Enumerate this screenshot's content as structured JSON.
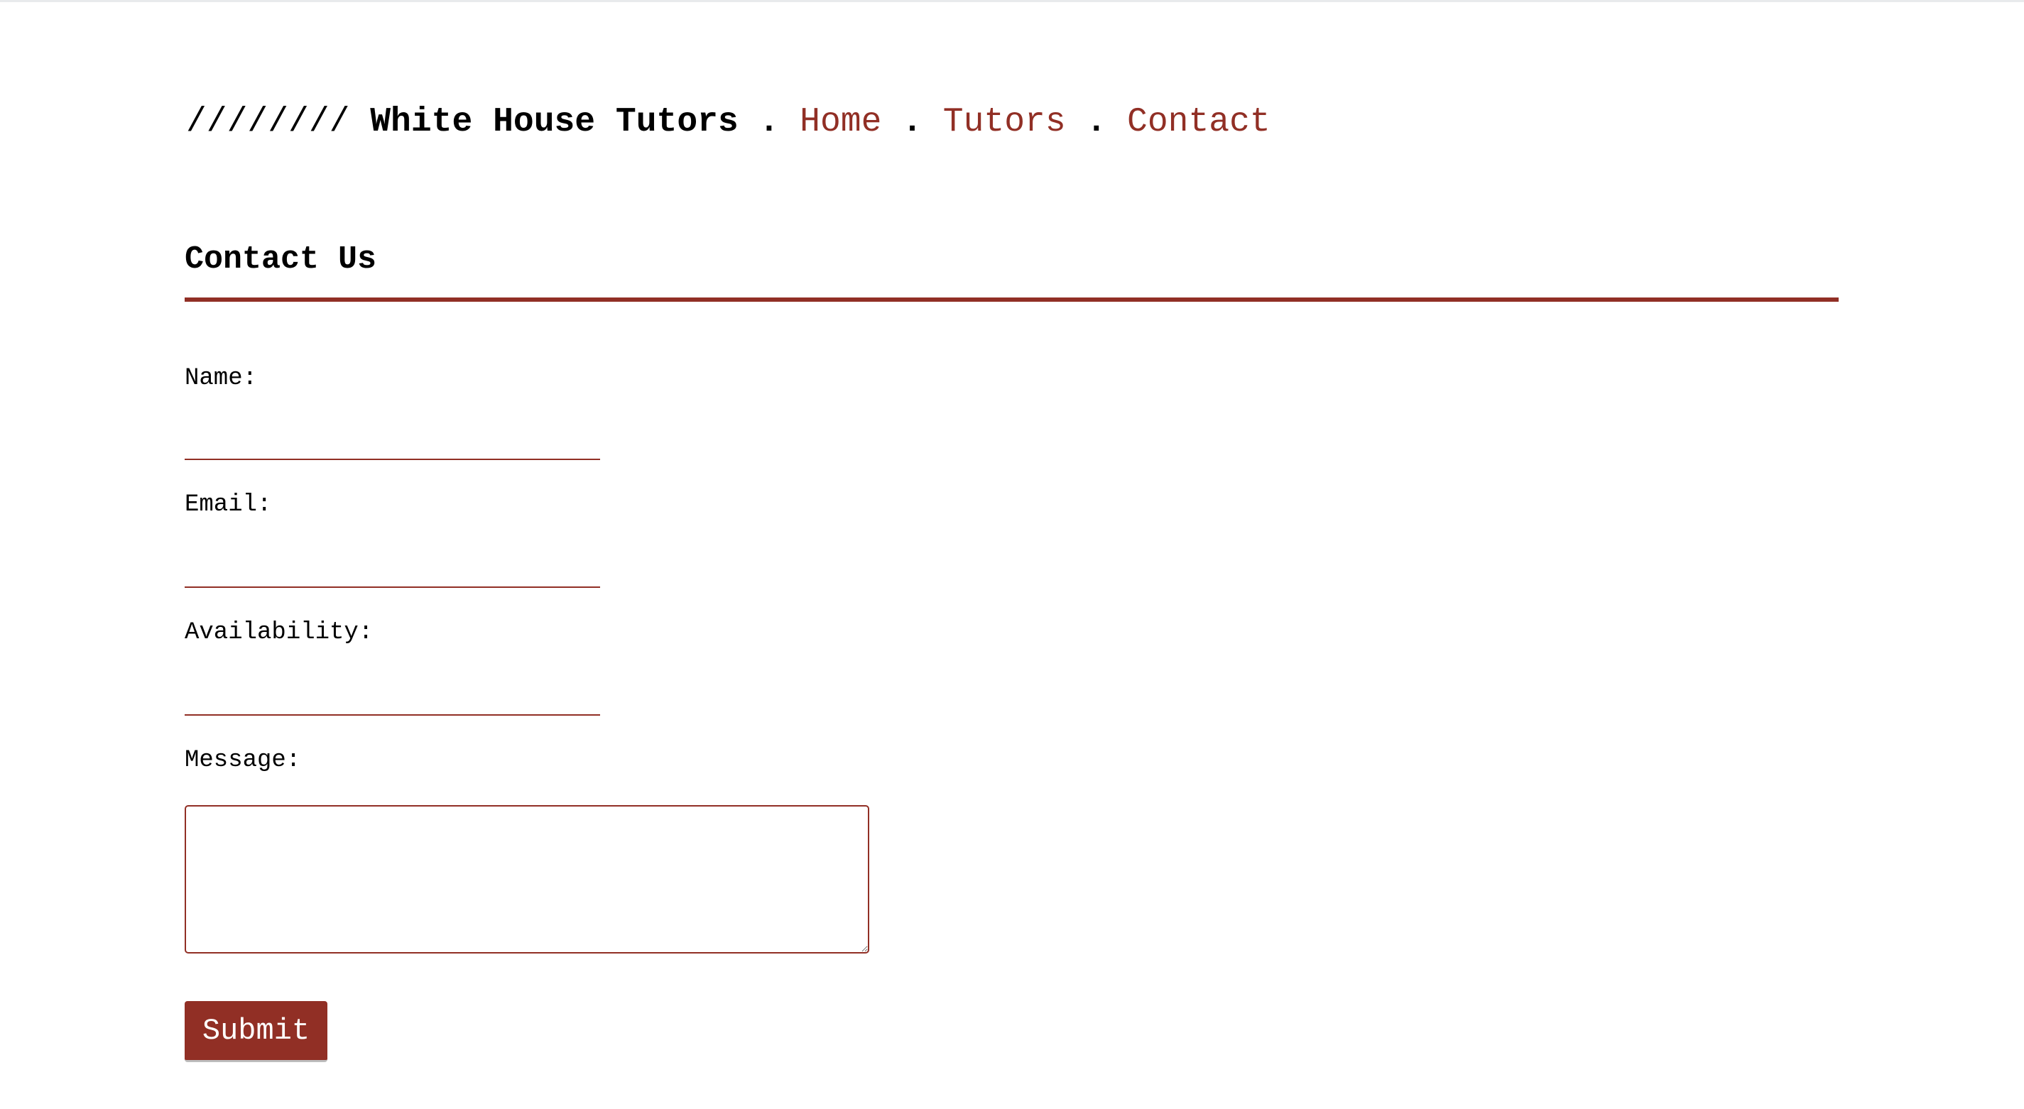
{
  "header": {
    "slashes": "////////",
    "brand": "White House Tutors",
    "separator": " . ",
    "nav": [
      {
        "label": "Home"
      },
      {
        "label": "Tutors"
      },
      {
        "label": "Contact"
      }
    ]
  },
  "page_title": "Contact Us",
  "form": {
    "name_label": "Name:",
    "name_value": "",
    "email_label": "Email:",
    "email_value": "",
    "availability_label": "Availability:",
    "availability_value": "",
    "message_label": "Message:",
    "message_value": "",
    "submit_label": "Submit"
  },
  "colors": {
    "accent": "#912f25"
  }
}
